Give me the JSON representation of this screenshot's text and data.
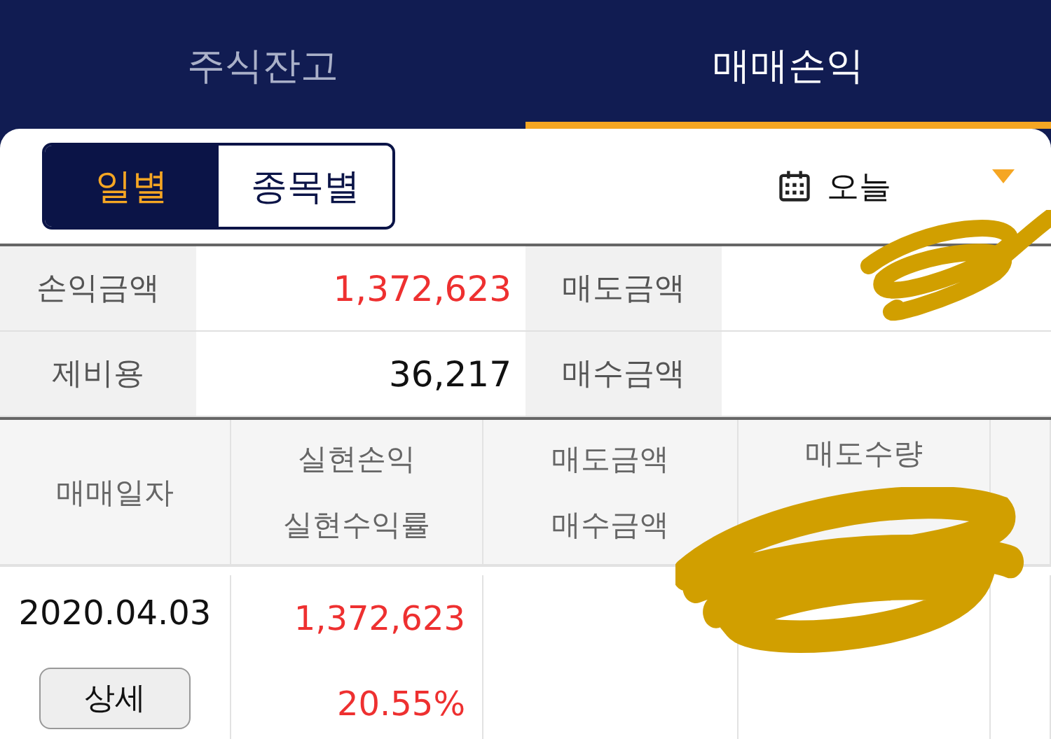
{
  "tabs": [
    {
      "label": "주식잔고",
      "selected": false
    },
    {
      "label": "매매손익",
      "selected": true
    }
  ],
  "view_toggle": [
    {
      "label": "일별",
      "selected": true
    },
    {
      "label": "종목별",
      "selected": false
    }
  ],
  "date_filter": {
    "value": "오늘"
  },
  "summary": [
    {
      "label": "손익금액",
      "value": "1,372,623",
      "kind": "gain"
    },
    {
      "label": "매도금액"
    },
    {
      "label": "제비용",
      "value": "36,217",
      "kind": "plain"
    },
    {
      "label": "매수금액"
    }
  ],
  "table": {
    "columns": [
      {
        "lines": [
          "매매일자"
        ]
      },
      {
        "lines": [
          "실현손익",
          "실현수익률"
        ]
      },
      {
        "lines": [
          "매도금액",
          "매수금액"
        ]
      },
      {
        "lines": [
          "매도수량"
        ]
      }
    ],
    "rows": [
      {
        "date": "2020.04.03",
        "button": "상세",
        "profit": "1,372,623",
        "rate": "20.55%"
      }
    ]
  },
  "redactions": [
    {
      "kind": "scribble"
    },
    {
      "kind": "scribble"
    }
  ]
}
